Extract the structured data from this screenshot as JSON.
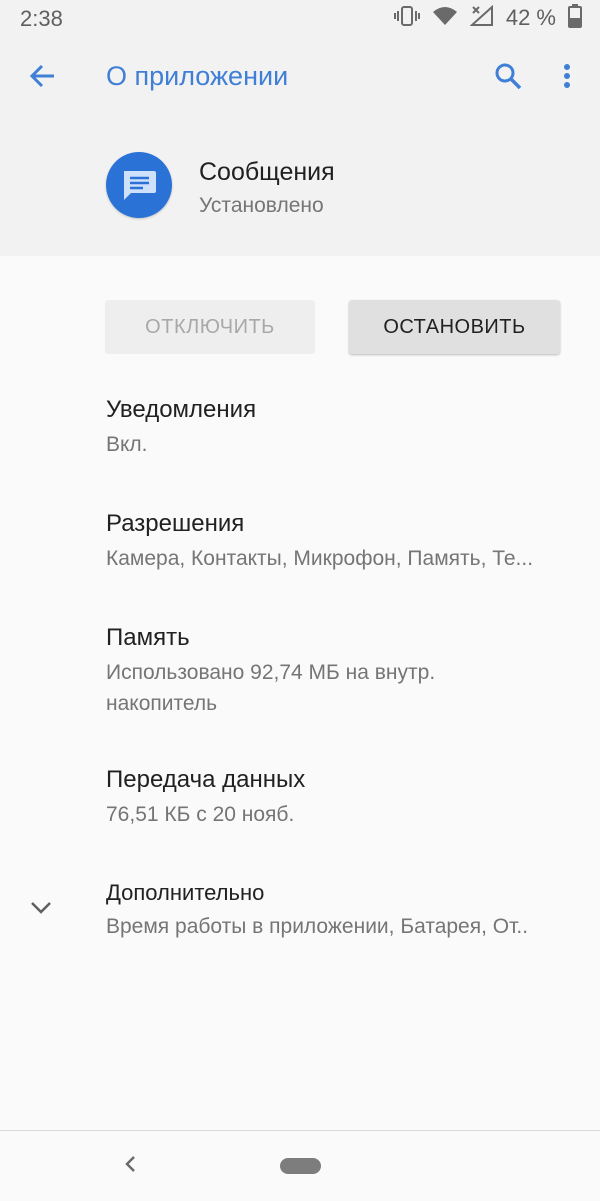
{
  "status_bar": {
    "time": "2:38",
    "battery_percent": "42 %",
    "icons": [
      "vibrate-icon",
      "wifi-icon",
      "no-signal-icon",
      "battery-icon"
    ]
  },
  "header": {
    "title": "О приложении",
    "app_name": "Сообщения",
    "app_status": "Установлено",
    "icons": [
      "back-arrow-icon",
      "search-icon",
      "more-vert-icon",
      "messages-app-icon"
    ]
  },
  "buttons": {
    "disable_label": "ОТКЛЮЧИТЬ",
    "stop_label": "ОСТАНОВИТЬ"
  },
  "items": [
    {
      "title": "Уведомления",
      "subtitle": "Вкл."
    },
    {
      "title": "Разрешения",
      "subtitle": "Камера, Контакты, Микрофон, Память, Те..."
    },
    {
      "title": "Память",
      "subtitle": "Использовано 92,74 МБ на внутр. накопитель"
    },
    {
      "title": "Передача данных",
      "subtitle": "76,51 КБ с 20 нояб."
    },
    {
      "title": "Дополнительно",
      "subtitle": "Время работы в приложении, Батарея, От.."
    }
  ],
  "colors": {
    "accent": "#3f7fd6",
    "app_icon": "#2a72d6",
    "header_bg": "#f2f2f2",
    "page_bg": "#fafafa"
  }
}
